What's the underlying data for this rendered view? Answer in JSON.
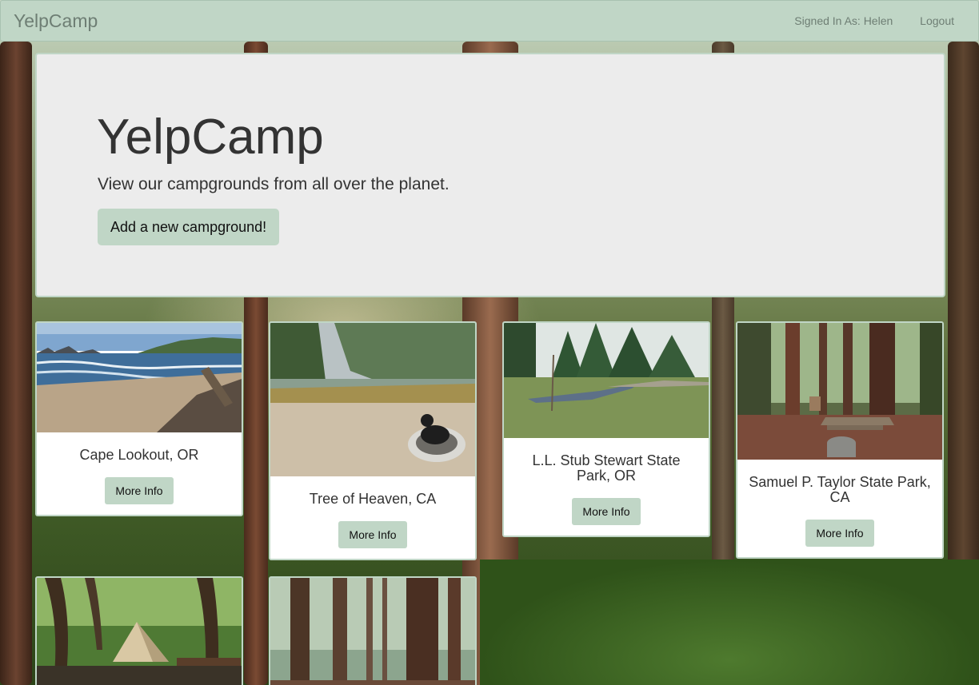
{
  "navbar": {
    "brand": "YelpCamp",
    "signed_in": "Signed In As: Helen",
    "logout": "Logout"
  },
  "jumbotron": {
    "title": "YelpCamp",
    "lead": "View our campgrounds from all over the planet.",
    "add_button": "Add a new campground!"
  },
  "campgrounds": [
    {
      "name": "Cape Lookout, OR",
      "button": "More Info"
    },
    {
      "name": "Tree of Heaven, CA",
      "button": "More Info"
    },
    {
      "name": "L.L. Stub Stewart State Park, OR",
      "button": "More Info"
    },
    {
      "name": "Samuel P. Taylor State Park, CA",
      "button": "More Info"
    },
    {
      "name": "",
      "button": ""
    },
    {
      "name": "",
      "button": ""
    }
  ],
  "colors": {
    "accent": "#c0d6c6",
    "jumbotron_bg": "#ececec",
    "text": "#333333"
  }
}
